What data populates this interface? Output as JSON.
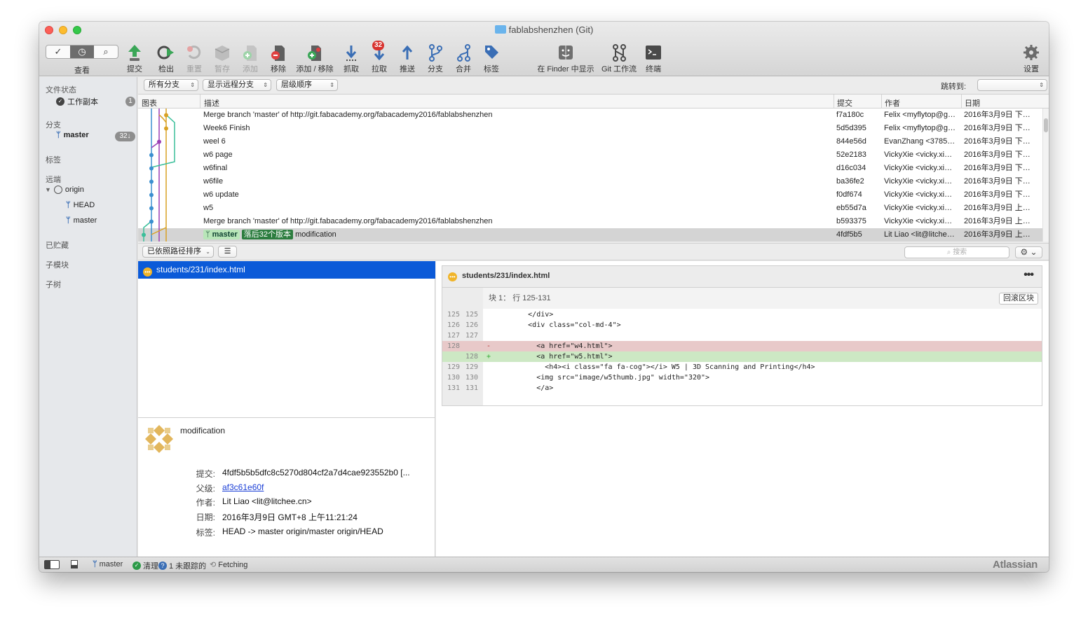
{
  "window": {
    "title": "fablabshenzhen (Git)"
  },
  "toolbar": {
    "view_label": "查看",
    "items": [
      {
        "label": "提交",
        "icon": "commit-icon"
      },
      {
        "label": "检出",
        "icon": "checkout-icon"
      },
      {
        "label": "重置",
        "icon": "reset-icon"
      },
      {
        "label": "暂存",
        "icon": "stash-icon"
      },
      {
        "label": "添加",
        "icon": "add-icon"
      },
      {
        "label": "移除",
        "icon": "remove-icon"
      },
      {
        "label": "添加 / 移除",
        "icon": "add-remove-icon"
      },
      {
        "label": "抓取",
        "icon": "fetch-icon"
      },
      {
        "label": "拉取",
        "icon": "pull-icon",
        "badge": "32"
      },
      {
        "label": "推送",
        "icon": "push-icon"
      },
      {
        "label": "分支",
        "icon": "branch-icon"
      },
      {
        "label": "合并",
        "icon": "merge-icon"
      },
      {
        "label": "标签",
        "icon": "tag-icon"
      },
      {
        "label": "在 Finder 中显示",
        "icon": "finder-icon"
      },
      {
        "label": "Git 工作流",
        "icon": "git-flow-icon"
      },
      {
        "label": "终端",
        "icon": "terminal-icon"
      },
      {
        "label": "设置",
        "icon": "settings-gear-icon"
      }
    ]
  },
  "filters": {
    "branches": "所有分支",
    "remote": "显示远程分支",
    "order": "层级顺序",
    "jump_label": "跳转到:"
  },
  "sidebar": {
    "file_status": "文件状态",
    "working_copy": "工作副本",
    "working_copy_badge": "1",
    "branches": "分支",
    "master": "master",
    "master_badge": "32↓",
    "tags": "标签",
    "remotes": "远端",
    "origin": "origin",
    "origin_head": "HEAD",
    "origin_master": "master",
    "stashes": "已贮藏",
    "submodules": "子模块",
    "subtrees": "子树"
  },
  "columns": {
    "graph": "图表",
    "desc": "描述",
    "commit": "提交",
    "author": "作者",
    "date": "日期"
  },
  "commits": [
    {
      "desc": "Merge branch 'master' of http://git.fabacademy.org/fabacademy2016/fablabshenzhen",
      "hash": "f7a180c",
      "author": "Felix <myflytop@g…",
      "date": "2016年3月9日 下…"
    },
    {
      "desc": "Week6 Finish",
      "hash": "5d5d395",
      "author": "Felix <myflytop@g…",
      "date": "2016年3月9日 下…"
    },
    {
      "desc": "weel 6",
      "hash": "844e56d",
      "author": "EvanZhang <3785…",
      "date": "2016年3月9日 下…"
    },
    {
      "desc": "w6 page",
      "hash": "52e2183",
      "author": "VickyXie <vicky.xi…",
      "date": "2016年3月9日 下…"
    },
    {
      "desc": "w6final",
      "hash": "d16c034",
      "author": "VickyXie <vicky.xi…",
      "date": "2016年3月9日 下…"
    },
    {
      "desc": "w6file",
      "hash": "ba36fe2",
      "author": "VickyXie <vicky.xi…",
      "date": "2016年3月9日 下…"
    },
    {
      "desc": "w6 update",
      "hash": "f0df674",
      "author": "VickyXie <vicky.xi…",
      "date": "2016年3月9日 下…"
    },
    {
      "desc": "w5",
      "hash": "eb55d7a",
      "author": "VickyXie <vicky.xi…",
      "date": "2016年3月9日 上…"
    },
    {
      "desc": "Merge branch 'master' of http://git.fabacademy.org/fabacademy2016/fablabshenzhen",
      "hash": "b593375",
      "author": "VickyXie <vicky.xi…",
      "date": "2016年3月9日 上…"
    },
    {
      "desc": "modification",
      "hash": "4fdf5b5",
      "author": "Lit Liao <lit@litche…",
      "date": "2016年3月9日 上…",
      "tag_branch": "master",
      "tag_behind": "落后32个版本"
    }
  ],
  "midbar": {
    "sort": "已依照路径排序",
    "search_placeholder": "搜索"
  },
  "file": {
    "name": "students/231/index.html"
  },
  "diff": {
    "file": "students/231/index.html",
    "hunk": "块 1： 行 125-131",
    "revert": "回滚区块",
    "lines": [
      {
        "o": "125",
        "n": "125",
        "s": "",
        "t": "        </div>",
        "k": "ctx"
      },
      {
        "o": "126",
        "n": "126",
        "s": "",
        "t": "        <div class=\"col-md-4\">",
        "k": "ctx"
      },
      {
        "o": "127",
        "n": "127",
        "s": "",
        "t": "",
        "k": "ctx"
      },
      {
        "o": "128",
        "n": "",
        "s": "-",
        "t": "          <a href=\"w4.html\">",
        "k": "del"
      },
      {
        "o": "",
        "n": "128",
        "s": "+",
        "t": "          <a href=\"w5.html\">",
        "k": "add"
      },
      {
        "o": "129",
        "n": "129",
        "s": "",
        "t": "            <h4><i class=\"fa fa-cog\"></i> W5 | 3D Scanning and Printing</h4>",
        "k": "ctx"
      },
      {
        "o": "130",
        "n": "130",
        "s": "",
        "t": "          <img src=\"image/w5thumb.jpg\" width=\"320\">",
        "k": "ctx"
      },
      {
        "o": "131",
        "n": "131",
        "s": "",
        "t": "          </a>",
        "k": "ctx"
      }
    ]
  },
  "details": {
    "message": "modification",
    "commit_label": "提交:",
    "commit": "4fdf5b5b5dfc8c5270d804cf2a7d4cae923552b0 [...",
    "parent_label": "父级:",
    "parent": "af3c61e60f",
    "author_label": "作者:",
    "author": "Lit Liao <lit@litchee.cn>",
    "date_label": "日期:",
    "date": "2016年3月9日 GMT+8 上午11:21:24",
    "tags_label": "标签:",
    "tags": "HEAD -> master origin/master origin/HEAD"
  },
  "status": {
    "branch": "master",
    "clean": "清理",
    "untracked": "1 未跟踪的",
    "fetching": "Fetching",
    "brand": "Atlassian"
  },
  "colors": {
    "selection": "#0b5ad8",
    "del_bg": "#e8c9c9",
    "add_bg": "#cde8c4",
    "behind_tag": "#2c7d3f"
  }
}
